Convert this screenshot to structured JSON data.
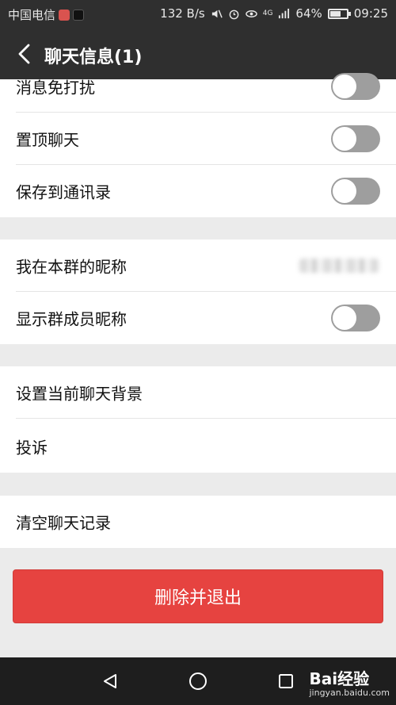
{
  "status_bar": {
    "carrier": "中国电信",
    "speed": "132 B/s",
    "network": "4G",
    "battery": "64%",
    "battery_level": 0.64,
    "time": "09:25"
  },
  "header": {
    "title": "聊天信息(1)",
    "back_icon": "chevron-left-icon"
  },
  "sections": {
    "s1": {
      "mute_label": "消息免打扰",
      "mute_on": false,
      "pin_label": "置顶聊天",
      "pin_on": false,
      "save_label": "保存到通讯录",
      "save_on": false
    },
    "s2": {
      "nickname_label": "我在本群的昵称",
      "show_nick_label": "显示群成员昵称",
      "show_nick_on": false
    },
    "s3": {
      "bg_label": "设置当前聊天背景",
      "report_label": "投诉"
    },
    "s4": {
      "clear_label": "清空聊天记录"
    }
  },
  "exit_button": "删除并退出",
  "watermark": {
    "brand": "Bai经验",
    "url": "jingyan.baidu.com"
  },
  "colors": {
    "header_bg": "#2f2f2f",
    "danger": "#e64340",
    "toggle_off": "#9e9e9e"
  }
}
